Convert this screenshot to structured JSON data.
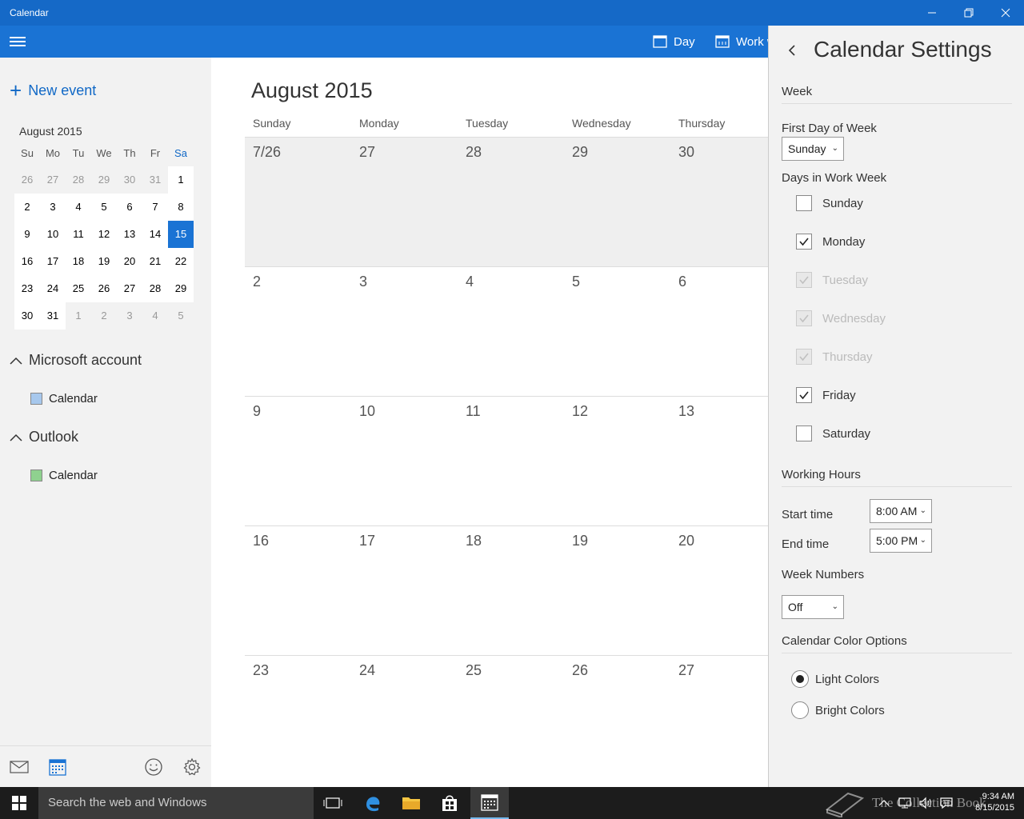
{
  "window": {
    "title": "Calendar"
  },
  "appbar": {
    "day_label": "Day",
    "workweek_label": "Work w"
  },
  "left": {
    "new_event_label": "New event",
    "mini_calendar": {
      "title": "August 2015",
      "weekdays": [
        "Su",
        "Mo",
        "Tu",
        "We",
        "Th",
        "Fr",
        "Sa"
      ],
      "weeks": [
        [
          "26",
          "27",
          "28",
          "29",
          "30",
          "31",
          "1"
        ],
        [
          "2",
          "3",
          "4",
          "5",
          "6",
          "7",
          "8"
        ],
        [
          "9",
          "10",
          "11",
          "12",
          "13",
          "14",
          "15"
        ],
        [
          "16",
          "17",
          "18",
          "19",
          "20",
          "21",
          "22"
        ],
        [
          "23",
          "24",
          "25",
          "26",
          "27",
          "28",
          "29"
        ],
        [
          "30",
          "31",
          "1",
          "2",
          "3",
          "4",
          "5"
        ]
      ],
      "selected": "15"
    },
    "accounts": [
      {
        "name": "Microsoft account",
        "calendar": "Calendar",
        "color": "#a7c8ed"
      },
      {
        "name": "Outlook",
        "calendar": "Calendar",
        "color": "#8fd18f"
      }
    ]
  },
  "main": {
    "month_title": "August 2015",
    "day_headers": [
      "Sunday",
      "Monday",
      "Tuesday",
      "Wednesday",
      "Thursday"
    ],
    "weeks": [
      [
        "7/26",
        "27",
        "28",
        "29",
        "30"
      ],
      [
        "2",
        "3",
        "4",
        "5",
        "6"
      ],
      [
        "9",
        "10",
        "11",
        "12",
        "13"
      ],
      [
        "16",
        "17",
        "18",
        "19",
        "20"
      ],
      [
        "23",
        "24",
        "25",
        "26",
        "27"
      ]
    ]
  },
  "settings": {
    "title": "Calendar Settings",
    "week_section": "Week",
    "first_day_label": "First Day of Week",
    "first_day_value": "Sunday",
    "work_week_label": "Days in Work Week",
    "days": [
      {
        "label": "Sunday",
        "checked": false,
        "disabled": false
      },
      {
        "label": "Monday",
        "checked": true,
        "disabled": false
      },
      {
        "label": "Tuesday",
        "checked": true,
        "disabled": true
      },
      {
        "label": "Wednesday",
        "checked": true,
        "disabled": true
      },
      {
        "label": "Thursday",
        "checked": true,
        "disabled": true
      },
      {
        "label": "Friday",
        "checked": true,
        "disabled": false
      },
      {
        "label": "Saturday",
        "checked": false,
        "disabled": false
      }
    ],
    "working_hours_section": "Working Hours",
    "start_time_label": "Start time",
    "start_time_value": "8:00 AM",
    "end_time_label": "End time",
    "end_time_value": "5:00 PM",
    "week_numbers_section": "Week Numbers",
    "week_numbers_value": "Off",
    "color_options_section": "Calendar Color Options",
    "color_options": [
      {
        "label": "Light Colors",
        "selected": true
      },
      {
        "label": "Bright Colors",
        "selected": false
      }
    ]
  },
  "taskbar": {
    "search_placeholder": "Search the web and Windows",
    "time": "9:34 AM",
    "date": "8/15/2015",
    "watermark": "The Collection Book"
  },
  "colors": {
    "accent": "#1a73d4",
    "titlebar": "#1569c7",
    "taskbar": "#1c1c1c"
  }
}
